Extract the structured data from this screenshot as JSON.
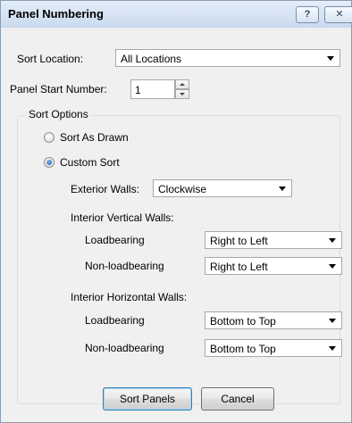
{
  "window": {
    "title": "Panel Numbering",
    "help_label": "?",
    "close_label": "✕"
  },
  "sort_location": {
    "label": "Sort Location:",
    "value": "All Locations"
  },
  "panel_start": {
    "label": "Panel Start Number:",
    "value": "1"
  },
  "sort_options": {
    "title": "Sort Options",
    "sort_as_drawn": "Sort As Drawn",
    "custom_sort": "Custom Sort",
    "selected": "custom_sort",
    "exterior_walls": {
      "label": "Exterior Walls:",
      "value": "Clockwise"
    },
    "interior_vertical": {
      "title": "Interior Vertical Walls:",
      "loadbearing": {
        "label": "Loadbearing",
        "value": "Right to Left"
      },
      "nonloadbearing": {
        "label": "Non-loadbearing",
        "value": "Right to Left"
      }
    },
    "interior_horizontal": {
      "title": "Interior Horizontal Walls:",
      "loadbearing": {
        "label": "Loadbearing",
        "value": "Bottom to Top"
      },
      "nonloadbearing": {
        "label": "Non-loadbearing",
        "value": "Bottom to Top"
      }
    }
  },
  "buttons": {
    "sort": "Sort Panels",
    "cancel": "Cancel"
  }
}
